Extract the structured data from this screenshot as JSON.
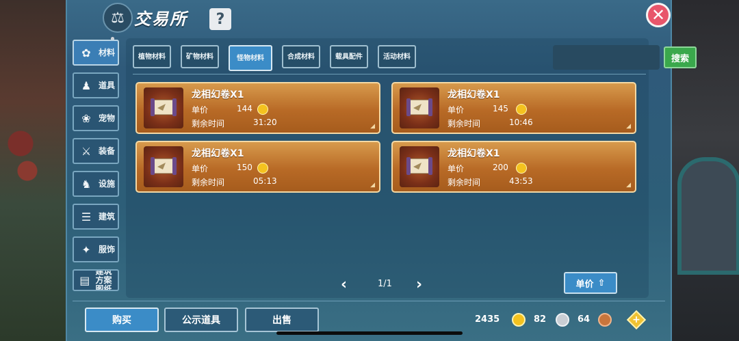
{
  "header": {
    "title": "交易所",
    "help_label": "?",
    "close_label": "✕"
  },
  "sidebar": {
    "items": [
      {
        "label": "材料",
        "icon": "materials-icon",
        "active": true
      },
      {
        "label": "道具",
        "icon": "item-icon",
        "active": false
      },
      {
        "label": "宠物",
        "icon": "paw-icon",
        "active": false
      },
      {
        "label": "装备",
        "icon": "equipment-icon",
        "active": false
      },
      {
        "label": "设施",
        "icon": "facility-icon",
        "active": false
      },
      {
        "label": "建筑",
        "icon": "building-icon",
        "active": false
      },
      {
        "label": "服饰",
        "icon": "clothing-icon",
        "active": false
      },
      {
        "label": "建筑方案图纸",
        "icon": "blueprint-icon",
        "active": false
      }
    ]
  },
  "tabs": [
    {
      "label": "植物材料"
    },
    {
      "label": "矿物材料"
    },
    {
      "label": "怪物材料",
      "active": true
    },
    {
      "label": "合成材料"
    },
    {
      "label": "载具配件"
    },
    {
      "label": "活动材料"
    }
  ],
  "search": {
    "placeholder": "",
    "button_label": "搜索"
  },
  "listings": [
    {
      "name": "龙相幻卷X1",
      "price_label": "单价",
      "price": "144",
      "time_label": "剩余时间",
      "time": "31:20"
    },
    {
      "name": "龙相幻卷X1",
      "price_label": "单价",
      "price": "145",
      "time_label": "剩余时间",
      "time": "10:46"
    },
    {
      "name": "龙相幻卷X1",
      "price_label": "单价",
      "price": "150",
      "time_label": "剩余时间",
      "time": "05:13"
    },
    {
      "name": "龙相幻卷X1",
      "price_label": "单价",
      "price": "200",
      "time_label": "剩余时间",
      "time": "43:53"
    }
  ],
  "pager": {
    "text": "1/1"
  },
  "sort": {
    "label": "单价"
  },
  "bottom": {
    "buy_label": "购买",
    "public_label": "公示道具",
    "sell_label": "出售"
  },
  "currency": {
    "gold": "2435",
    "silver": "82",
    "copper": "64",
    "gold_color": "#f4c21f",
    "silver_color": "#c9ced4",
    "copper_color": "#c8753c"
  }
}
